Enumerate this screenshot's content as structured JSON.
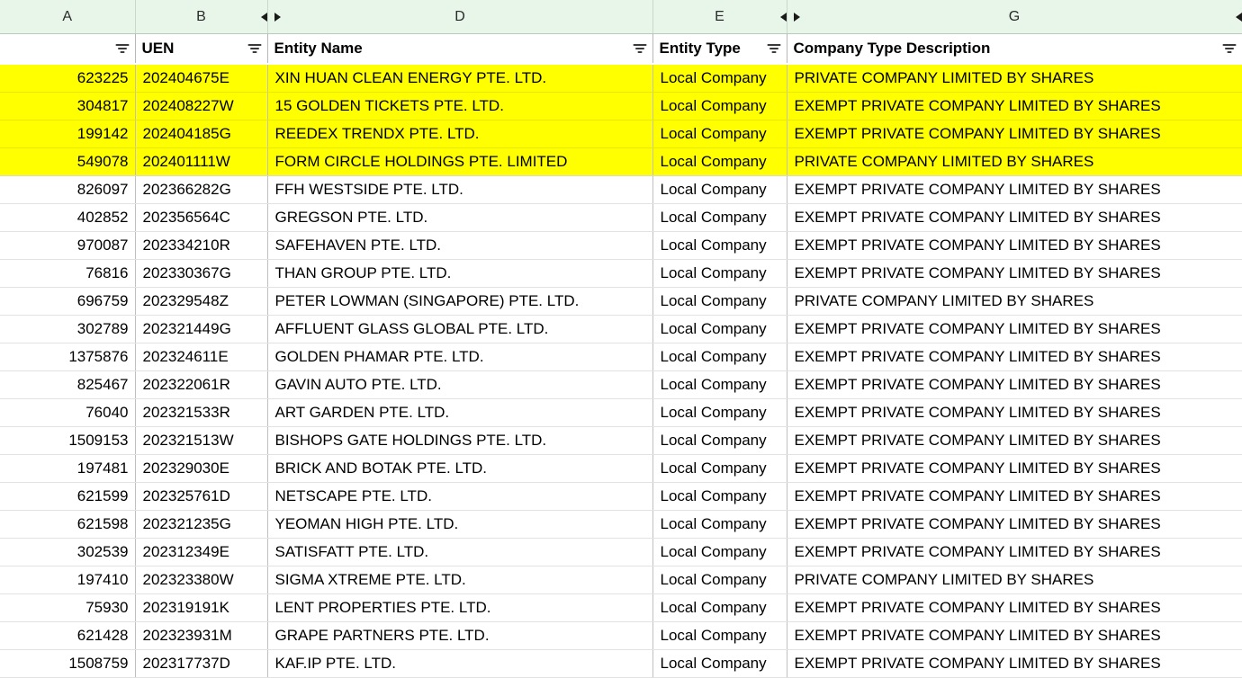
{
  "app": {
    "type": "spreadsheet",
    "accent_header_bg": "#e8f5e9",
    "highlight_color": "#ffff00"
  },
  "columns": {
    "letters": [
      {
        "letter": "A",
        "hidden_after": false,
        "hidden_before": false
      },
      {
        "letter": "B",
        "hidden_after": true,
        "hidden_before": false
      },
      {
        "letter": "D",
        "hidden_after": false,
        "hidden_before": true
      },
      {
        "letter": "E",
        "hidden_after": true,
        "hidden_before": false
      },
      {
        "letter": "G",
        "hidden_after": true,
        "hidden_before": true
      }
    ]
  },
  "filter_row": {
    "a_label": "",
    "b_label": "UEN",
    "d_label": "Entity Name",
    "e_label": "Entity Type",
    "g_label": "Company Type Description",
    "icon": "filter-funnel-icon"
  },
  "table": {
    "headers": [
      "",
      "UEN",
      "Entity Name",
      "Entity Type",
      "Company Type Description"
    ],
    "rows": [
      {
        "a": "623225",
        "b": "202404675E",
        "d": "XIN HUAN CLEAN ENERGY PTE. LTD.",
        "e": "Local Company",
        "g": "PRIVATE COMPANY LIMITED BY SHARES",
        "highlighted": true
      },
      {
        "a": "304817",
        "b": "202408227W",
        "d": "15 GOLDEN TICKETS PTE. LTD.",
        "e": "Local Company",
        "g": "EXEMPT PRIVATE COMPANY LIMITED BY SHARES",
        "highlighted": true
      },
      {
        "a": "199142",
        "b": "202404185G",
        "d": "REEDEX TRENDX PTE. LTD.",
        "e": "Local Company",
        "g": "EXEMPT PRIVATE COMPANY LIMITED BY SHARES",
        "highlighted": true
      },
      {
        "a": "549078",
        "b": "202401111W",
        "d": "FORM CIRCLE HOLDINGS PTE. LIMITED",
        "e": "Local Company",
        "g": "PRIVATE COMPANY LIMITED BY SHARES",
        "highlighted": true
      },
      {
        "a": "826097",
        "b": "202366282G",
        "d": "FFH WESTSIDE PTE. LTD.",
        "e": "Local Company",
        "g": "EXEMPT PRIVATE COMPANY LIMITED BY SHARES",
        "highlighted": false
      },
      {
        "a": "402852",
        "b": "202356564C",
        "d": "GREGSON PTE. LTD.",
        "e": "Local Company",
        "g": "EXEMPT PRIVATE COMPANY LIMITED BY SHARES",
        "highlighted": false
      },
      {
        "a": "970087",
        "b": "202334210R",
        "d": "SAFEHAVEN PTE. LTD.",
        "e": "Local Company",
        "g": "EXEMPT PRIVATE COMPANY LIMITED BY SHARES",
        "highlighted": false
      },
      {
        "a": "76816",
        "b": "202330367G",
        "d": "THAN GROUP PTE. LTD.",
        "e": "Local Company",
        "g": "EXEMPT PRIVATE COMPANY LIMITED BY SHARES",
        "highlighted": false
      },
      {
        "a": "696759",
        "b": "202329548Z",
        "d": "PETER LOWMAN (SINGAPORE) PTE. LTD.",
        "e": "Local Company",
        "g": "PRIVATE COMPANY LIMITED BY SHARES",
        "highlighted": false
      },
      {
        "a": "302789",
        "b": "202321449G",
        "d": "AFFLUENT GLASS GLOBAL PTE. LTD.",
        "e": "Local Company",
        "g": "EXEMPT PRIVATE COMPANY LIMITED BY SHARES",
        "highlighted": false
      },
      {
        "a": "1375876",
        "b": "202324611E",
        "d": "GOLDEN PHAMAR PTE. LTD.",
        "e": "Local Company",
        "g": "EXEMPT PRIVATE COMPANY LIMITED BY SHARES",
        "highlighted": false
      },
      {
        "a": "825467",
        "b": "202322061R",
        "d": "GAVIN AUTO PTE. LTD.",
        "e": "Local Company",
        "g": "EXEMPT PRIVATE COMPANY LIMITED BY SHARES",
        "highlighted": false
      },
      {
        "a": "76040",
        "b": "202321533R",
        "d": "ART GARDEN PTE. LTD.",
        "e": "Local Company",
        "g": "EXEMPT PRIVATE COMPANY LIMITED BY SHARES",
        "highlighted": false
      },
      {
        "a": "1509153",
        "b": "202321513W",
        "d": "BISHOPS GATE HOLDINGS PTE. LTD.",
        "e": "Local Company",
        "g": "EXEMPT PRIVATE COMPANY LIMITED BY SHARES",
        "highlighted": false
      },
      {
        "a": "197481",
        "b": "202329030E",
        "d": "BRICK AND BOTAK PTE. LTD.",
        "e": "Local Company",
        "g": "EXEMPT PRIVATE COMPANY LIMITED BY SHARES",
        "highlighted": false
      },
      {
        "a": "621599",
        "b": "202325761D",
        "d": "NETSCAPE PTE. LTD.",
        "e": "Local Company",
        "g": "EXEMPT PRIVATE COMPANY LIMITED BY SHARES",
        "highlighted": false
      },
      {
        "a": "621598",
        "b": "202321235G",
        "d": "YEOMAN HIGH PTE. LTD.",
        "e": "Local Company",
        "g": "EXEMPT PRIVATE COMPANY LIMITED BY SHARES",
        "highlighted": false
      },
      {
        "a": "302539",
        "b": "202312349E",
        "d": "SATISFATT PTE. LTD.",
        "e": "Local Company",
        "g": "EXEMPT PRIVATE COMPANY LIMITED BY SHARES",
        "highlighted": false
      },
      {
        "a": "197410",
        "b": "202323380W",
        "d": "SIGMA XTREME PTE. LTD.",
        "e": "Local Company",
        "g": "PRIVATE COMPANY LIMITED BY SHARES",
        "highlighted": false
      },
      {
        "a": "75930",
        "b": "202319191K",
        "d": "LENT PROPERTIES PTE. LTD.",
        "e": "Local Company",
        "g": "EXEMPT PRIVATE COMPANY LIMITED BY SHARES",
        "highlighted": false
      },
      {
        "a": "621428",
        "b": "202323931M",
        "d": "GRAPE PARTNERS PTE. LTD.",
        "e": "Local Company",
        "g": "EXEMPT PRIVATE COMPANY LIMITED BY SHARES",
        "highlighted": false
      },
      {
        "a": "1508759",
        "b": "202317737D",
        "d": "KAF.IP PTE. LTD.",
        "e": "Local Company",
        "g": "EXEMPT PRIVATE COMPANY LIMITED BY SHARES",
        "highlighted": false
      }
    ]
  }
}
